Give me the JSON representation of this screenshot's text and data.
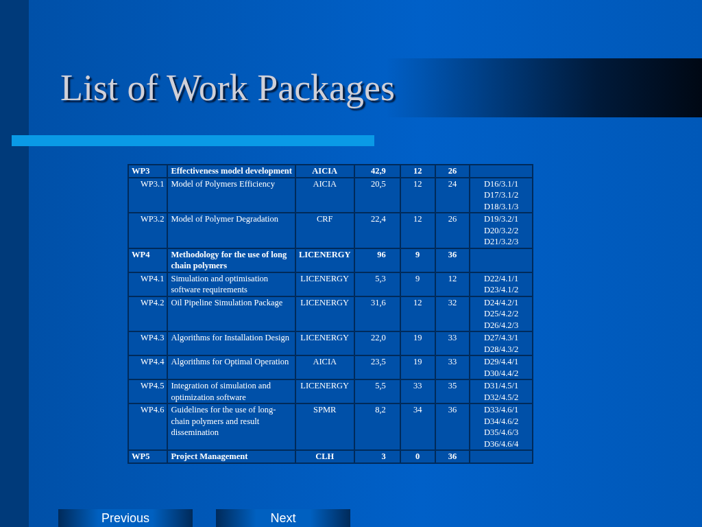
{
  "title": "List of Work Packages",
  "table": {
    "rows": [
      {
        "kind": "package",
        "id": "WP3",
        "name": "Effectiveness model development",
        "partner": "AICIA",
        "effort": "42,9",
        "start": "12",
        "end": "26",
        "deliverables": []
      },
      {
        "kind": "task",
        "id": "WP3.1",
        "name": "Model of Polymers Efficiency",
        "partner": "AICIA",
        "effort": "20,5",
        "start": "12",
        "end": "24",
        "deliverables": [
          "D16/3.1/1",
          "D17/3.1/2",
          "D18/3.1/3"
        ]
      },
      {
        "kind": "task",
        "id": "WP3.2",
        "name": "Model of Polymer Degradation",
        "partner": "CRF",
        "effort": "22,4",
        "start": "12",
        "end": "26",
        "deliverables": [
          "D19/3.2/1",
          "D20/3.2/2",
          "D21/3.2/3"
        ]
      },
      {
        "kind": "package",
        "id": "WP4",
        "name": "Methodology for the use of long chain polymers",
        "partner": "LICENERGY",
        "effort": "96",
        "start": "9",
        "end": "36",
        "deliverables": []
      },
      {
        "kind": "task",
        "id": "WP4.1",
        "name": "Simulation and optimisation software requirements",
        "partner": "LICENERGY",
        "effort": "5,3",
        "start": "9",
        "end": "12",
        "deliverables": [
          "D22/4.1/1",
          "D23/4.1/2"
        ]
      },
      {
        "kind": "task",
        "id": "WP4.2",
        "name": "Oil Pipeline Simulation Package",
        "partner": "LICENERGY",
        "effort": "31,6",
        "start": "12",
        "end": "32",
        "deliverables": [
          "D24/4.2/1",
          "D25/4.2/2",
          "D26/4.2/3"
        ]
      },
      {
        "kind": "task",
        "id": "WP4.3",
        "name": "Algorithms for Installation Design",
        "partner": "LICENERGY",
        "effort": "22,0",
        "start": "19",
        "end": "33",
        "deliverables": [
          "D27/4.3/1",
          "D28/4.3/2"
        ]
      },
      {
        "kind": "task",
        "id": "WP4.4",
        "name": "Algorithms for Optimal Operation",
        "partner": "AICIA",
        "effort": "23,5",
        "start": "19",
        "end": "33",
        "deliverables": [
          "D29/4.4/1",
          "D30/4.4/2"
        ]
      },
      {
        "kind": "task",
        "id": "WP4.5",
        "name": "Integration of simulation and optimization software",
        "partner": "LICENERGY",
        "effort": "5,5",
        "start": "33",
        "end": "35",
        "deliverables": [
          "D31/4.5/1",
          "D32/4.5/2"
        ]
      },
      {
        "kind": "task",
        "id": "WP4.6",
        "name": "Guidelines for the use of long-chain polymers and result dissemination",
        "partner": "SPMR",
        "effort": "8,2",
        "start": "34",
        "end": "36",
        "deliverables": [
          "D33/4.6/1",
          "D34/4.6/2",
          "D35/4.6/3",
          "D36/4.6/4"
        ]
      },
      {
        "kind": "package",
        "id": "WP5",
        "name": "Project Management",
        "partner": "CLH",
        "effort": "3",
        "start": "0",
        "end": "36",
        "deliverables": []
      }
    ]
  },
  "nav": {
    "previous": "Previous",
    "next": "Next"
  }
}
